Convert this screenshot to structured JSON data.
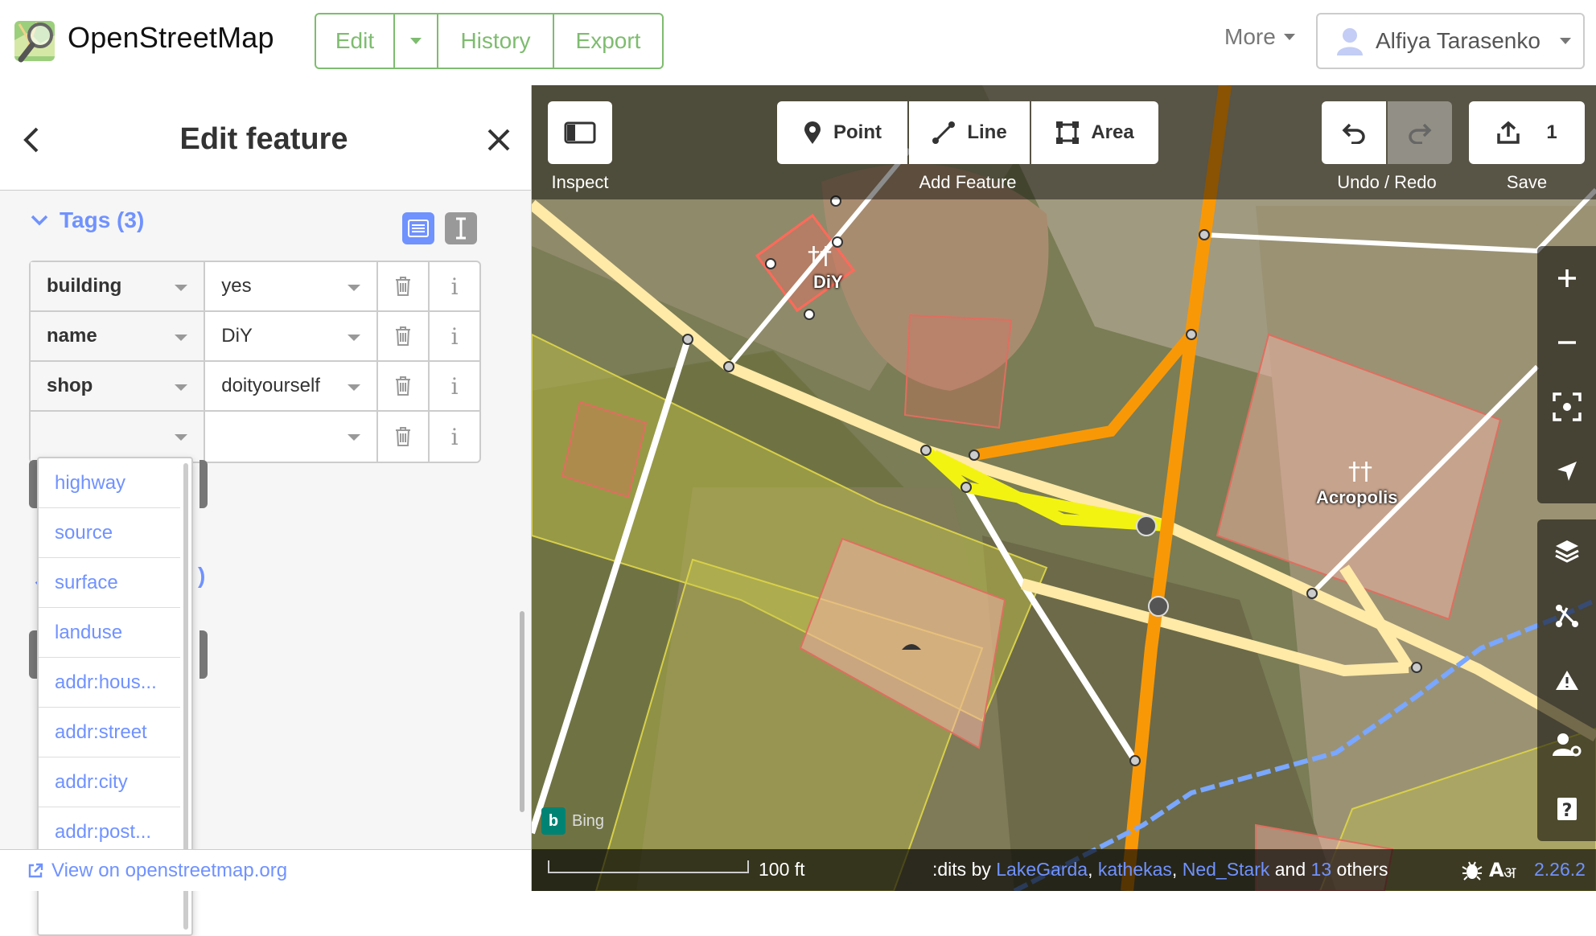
{
  "app": {
    "logo_text": "OpenStreetMap",
    "nav": {
      "edit": "Edit",
      "history": "History",
      "export": "Export",
      "more": "More"
    },
    "user": {
      "name": "Alfiya Tarasenko"
    }
  },
  "sidebar": {
    "title": "Edit feature",
    "tags_title": "Tags (3)",
    "tags": [
      {
        "key": "building",
        "value": "yes"
      },
      {
        "key": "name",
        "value": "DiY"
      },
      {
        "key": "shop",
        "value": "doityourself"
      },
      {
        "key": "",
        "value": ""
      }
    ],
    "partial_hidden_section_suffix": ")",
    "key_suggestions": [
      "highway",
      "source",
      "surface",
      "landuse",
      "addr:hous...",
      "addr:street",
      "addr:city",
      "addr:post..."
    ],
    "view_on_osm": "View on openstreetmap.org"
  },
  "toolbar": {
    "inspect_label": "Inspect",
    "point": "Point",
    "line": "Line",
    "area": "Area",
    "add_feature_label": "Add Feature",
    "undo_redo_label": "Undo / Redo",
    "save_count": "1",
    "save_label": "Save"
  },
  "map": {
    "labels": {
      "diy": "DiY",
      "acropolis": "Acropolis"
    },
    "bing_text": "Bing",
    "scale_text": "100 ft",
    "attribution": {
      "prefix": ":dits by ",
      "users": [
        "LakeGarda",
        "kathekas",
        "Ned_Stark"
      ],
      "and": " and ",
      "others_count": "13",
      "others": " others"
    },
    "version": "2.26.2"
  },
  "colors": {
    "osm_green": "#7ebc6f",
    "link_blue": "#7092ff",
    "primary_road": "#f99806",
    "secondary_road": "#f3f312",
    "tertiary_road": "#ffeaa7",
    "building_outline": "#e06e5f"
  },
  "icons": {
    "back": "chevron-left-icon",
    "close": "close-icon",
    "delete": "trash-icon",
    "info": "info-icon",
    "point": "map-pin-icon",
    "line": "line-icon",
    "area": "area-icon",
    "undo": "undo-icon",
    "redo": "redo-icon",
    "save": "upload-icon"
  }
}
